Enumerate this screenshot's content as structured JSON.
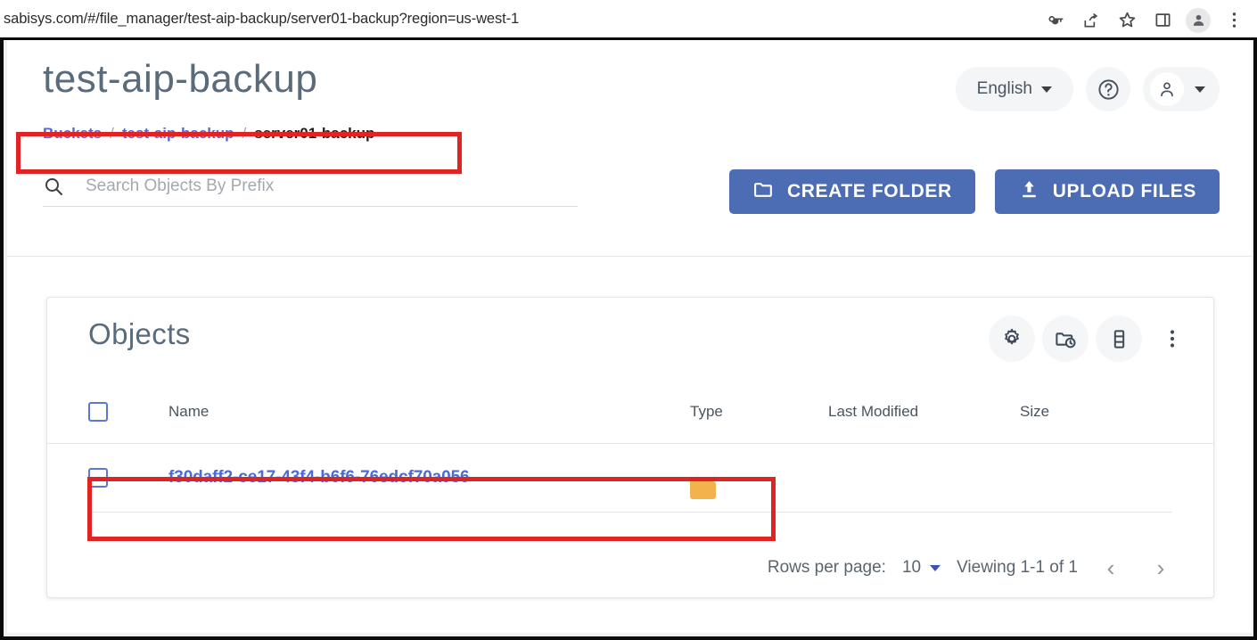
{
  "browser": {
    "url": "sabisys.com/#/file_manager/test-aip-backup/server01-backup?region=us-west-1",
    "icons": [
      "key-icon",
      "share-icon",
      "bookmark-star-icon",
      "side-panel-icon",
      "profile-avatar-icon",
      "kebab-menu-icon"
    ]
  },
  "header": {
    "title": "test-aip-backup",
    "language": "English",
    "help_icon": "help-circle-icon",
    "account_icon": "person-icon"
  },
  "breadcrumb": {
    "items": [
      {
        "label": "Buckets",
        "current": false
      },
      {
        "label": "test-aip-backup",
        "current": false
      },
      {
        "label": "server01-backup",
        "current": true
      }
    ],
    "separator": "/"
  },
  "search": {
    "placeholder": "Search Objects By Prefix",
    "value": "",
    "icon": "search-icon"
  },
  "actions": {
    "create_folder": "CREATE FOLDER",
    "create_folder_icon": "folder-icon",
    "upload_files": "UPLOAD FILES",
    "upload_files_icon": "upload-icon"
  },
  "objects_card": {
    "title": "Objects",
    "tools": [
      {
        "name": "settings-gear-icon",
        "label": "Settings"
      },
      {
        "name": "folder-history-icon",
        "label": "Object versions"
      },
      {
        "name": "storage-columns-icon",
        "label": "Storage"
      },
      {
        "name": "kebab-menu-icon",
        "label": "More options"
      }
    ],
    "columns": [
      "Name",
      "Type",
      "Last Modified",
      "Size"
    ],
    "rows": [
      {
        "name": "f30daff2-ce17-43f4-b6f6-76edcf70a056",
        "type_icon": "folder-icon",
        "last_modified": "",
        "size": "",
        "selected": false
      }
    ],
    "pagination": {
      "rows_per_page_label": "Rows per page:",
      "rows_per_page_value": "10",
      "viewing": "Viewing 1-1 of 1",
      "prev_icon": "chevron-left-icon",
      "next_icon": "chevron-right-icon"
    }
  },
  "colors": {
    "primary_button": "#4c6cb3",
    "link": "#4b6bd8",
    "folder": "#f3b34c",
    "annotation": "#e02323",
    "title": "#5a6b7b"
  }
}
